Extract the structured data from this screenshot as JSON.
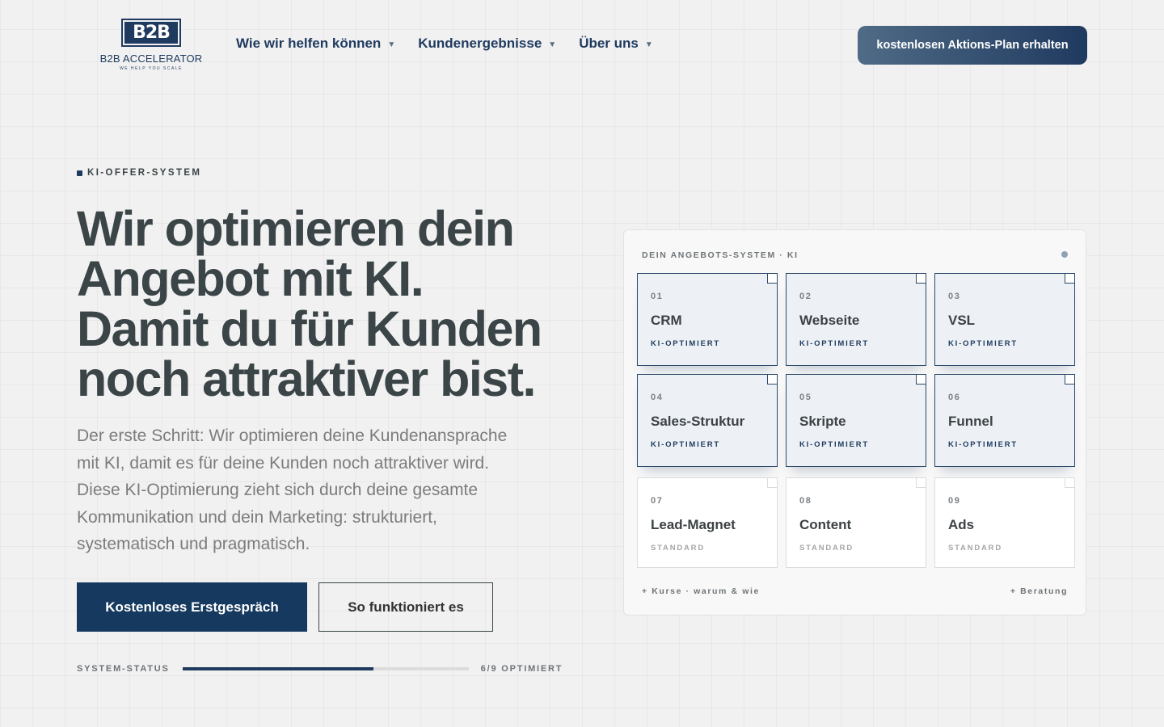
{
  "header": {
    "logo": {
      "mark": "B2B",
      "name": "B2B ACCELERATOR",
      "tagline": "WE HELP YOU SCALE"
    },
    "nav": [
      {
        "label": "Wie wir helfen können",
        "icon": "chevron-down-icon"
      },
      {
        "label": "Kundenergebnisse",
        "icon": "chevron-down-icon"
      },
      {
        "label": "Über uns",
        "icon": "chevron-down-icon"
      }
    ],
    "cta_label": "kostenlosen Aktions-Plan erhalten"
  },
  "hero": {
    "eyebrow": "KI-OFFER-SYSTEM",
    "headline_lines": [
      "Wir optimieren dein",
      "Angebot mit KI.",
      "Damit du für Kunden",
      "noch attraktiver bist."
    ],
    "subtext_lines": [
      "Der erste Schritt: Wir optimieren deine Kundenansprache",
      "mit KI, damit es für deine Kunden noch attraktiver wird.",
      "Diese KI-Optimierung zieht sich durch deine gesamte",
      "Kommunikation und dein Marketing: strukturiert,",
      "systematisch und pragmatisch."
    ],
    "primary_button": "Kostenloses Erstgespräch",
    "secondary_button": "So funktioniert es",
    "status": {
      "label": "SYSTEM-STATUS",
      "count_text": "6/9 OPTIMIERT",
      "optimized": 6,
      "total": 9
    }
  },
  "panel": {
    "title": "DEIN ANGEBOTS-SYSTEM · KI",
    "cards": [
      {
        "num": "01",
        "name": "CRM",
        "status": "KI-OPTIMIERT",
        "optimized": true
      },
      {
        "num": "02",
        "name": "Webseite",
        "status": "KI-OPTIMIERT",
        "optimized": true
      },
      {
        "num": "03",
        "name": "VSL",
        "status": "KI-OPTIMIERT",
        "optimized": true
      },
      {
        "num": "04",
        "name": "Sales-Struktur",
        "status": "KI-OPTIMIERT",
        "optimized": true
      },
      {
        "num": "05",
        "name": "Skripte",
        "status": "KI-OPTIMIERT",
        "optimized": true
      },
      {
        "num": "06",
        "name": "Funnel",
        "status": "KI-OPTIMIERT",
        "optimized": true
      },
      {
        "num": "07",
        "name": "Lead-Magnet",
        "status": "STANDARD",
        "optimized": false
      },
      {
        "num": "08",
        "name": "Content",
        "status": "STANDARD",
        "optimized": false
      },
      {
        "num": "09",
        "name": "Ads",
        "status": "STANDARD",
        "optimized": false
      }
    ],
    "footer_left": "+ Kurse · warum & wie",
    "footer_right": "+ Beratung"
  },
  "colors": {
    "brand": "#1f3a5f",
    "background": "#f1f1f1",
    "headline": "#3b4547",
    "muted": "#7c7c7c"
  }
}
